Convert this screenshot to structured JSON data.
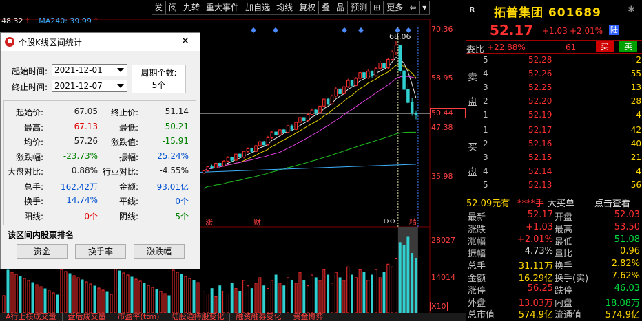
{
  "toolbar": [
    "发",
    "阅",
    "九转",
    "重大事件",
    "加自选",
    "均线",
    "复权",
    "叠",
    "品",
    "预测",
    "⊞",
    "更多",
    "⇦",
    "▾"
  ],
  "ma_legend": {
    "ma5": "48.32",
    "ma240": "MA240: 39.99"
  },
  "price_axis": [
    "70.36",
    "58.95",
    "47.38",
    "35.98"
  ],
  "current_price_tag": "50.44",
  "max_marker": "68.06",
  "chart_tags": {
    "zhang": "涨",
    "cai": "财",
    "period_marks": "↔↔",
    "jing": "精"
  },
  "vol_axis": [
    "28027",
    "14014"
  ],
  "vol_unit": "X10",
  "bottom_tabs": [
    "A行上核成交量",
    "盘后成交量",
    "市盈率(ttm)",
    "陆股通持股变化",
    "融资融券变化",
    "资金博弈"
  ],
  "dialog": {
    "title": "个股K线区间统计",
    "start_label": "起始时间:",
    "start_value": "2021-12-01",
    "end_label": "终止时间:",
    "end_value": "2021-12-07",
    "period_label": "周期个数:",
    "period_value": "5个",
    "stats_left": [
      {
        "label": "起始价:",
        "value": "67.05",
        "color": "black"
      },
      {
        "label": "最高:",
        "value": "67.13",
        "color": "red"
      },
      {
        "label": "均价:",
        "value": "57.26",
        "color": "black"
      },
      {
        "label": "涨跌幅:",
        "value": "-23.73%",
        "color": "green"
      },
      {
        "label": "大盘对比:",
        "value": "0.88%",
        "color": "black"
      },
      {
        "label": "总手:",
        "value": "162.42万",
        "color": "blue"
      },
      {
        "label": "换手:",
        "value": "14.74%",
        "color": "blue"
      },
      {
        "label": "阳线:",
        "value": "0个",
        "color": "red"
      }
    ],
    "stats_right": [
      {
        "label": "终止价:",
        "value": "51.14",
        "color": "black"
      },
      {
        "label": "最低:",
        "value": "50.21",
        "color": "green"
      },
      {
        "label": "涨跌值:",
        "value": "-15.91",
        "color": "green"
      },
      {
        "label": "振幅:",
        "value": "25.24%",
        "color": "blue"
      },
      {
        "label": "行业对比:",
        "value": "-4.55%",
        "color": "black"
      },
      {
        "label": "金额:",
        "value": "93.01亿",
        "color": "blue"
      },
      {
        "label": "平线:",
        "value": "0个",
        "color": "blue"
      },
      {
        "label": "阴线:",
        "value": "5个",
        "color": "green"
      }
    ],
    "rank_label": "该区间内股票排名",
    "buttons": [
      "资金",
      "换手率",
      "涨跌幅"
    ],
    "close": "✕"
  },
  "quote": {
    "r": "R",
    "name": "拓普集团 601689",
    "price": "52.17",
    "change": "+1.03",
    "pct": "+2.01%",
    "lu": "陆",
    "weibi_label": "委比",
    "weibi_pct": "+22.88%",
    "weibi_diff": "61",
    "buy_btn": "买",
    "sell_btn": "卖",
    "sell_side": [
      "卖",
      "盘"
    ],
    "buy_side": [
      "买",
      "盘"
    ],
    "asks": [
      {
        "lvl": "5",
        "price": "52.28",
        "vol": "2"
      },
      {
        "lvl": "4",
        "price": "52.26",
        "vol": "55"
      },
      {
        "lvl": "3",
        "price": "52.25",
        "vol": "13"
      },
      {
        "lvl": "2",
        "price": "52.20",
        "vol": "28"
      },
      {
        "lvl": "1",
        "price": "52.19",
        "vol": "4"
      }
    ],
    "bids": [
      {
        "lvl": "1",
        "price": "52.17",
        "vol": "42"
      },
      {
        "lvl": "2",
        "price": "52.16",
        "vol": "40"
      },
      {
        "lvl": "3",
        "price": "52.15",
        "vol": "21"
      },
      {
        "lvl": "4",
        "price": "52.14",
        "vol": "4"
      },
      {
        "lvl": "5",
        "price": "52.13",
        "vol": "56"
      }
    ],
    "bar": {
      "youyou": "52.09元有",
      "shou": "****手",
      "dmd": "大买单",
      "djck": "点击查看"
    },
    "stats": [
      {
        "l1": "最新",
        "v1": "52.17",
        "c1": "red",
        "l2": "开盘",
        "v2": "52.03",
        "c2": "red"
      },
      {
        "l1": "涨跌",
        "v1": "+1.03",
        "c1": "red",
        "l2": "最高",
        "v2": "53.50",
        "c2": "red"
      },
      {
        "l1": "涨幅",
        "v1": "+2.01%",
        "c1": "red",
        "l2": "最低",
        "v2": "51.08",
        "c2": "green"
      },
      {
        "l1": "振幅",
        "v1": "4.73%",
        "c1": "white",
        "l2": "量比",
        "v2": "0.96",
        "c2": "yellow"
      },
      {
        "l1": "总手",
        "v1": "31.11万",
        "c1": "yellow",
        "l2": "换手",
        "v2": "2.82%",
        "c2": "yellow"
      },
      {
        "l1": "金额",
        "v1": "16.29亿",
        "c1": "yellow",
        "l2": "换手(实)",
        "v2": "7.62%",
        "c2": "yellow"
      },
      {
        "l1": "涨停",
        "v1": "56.25",
        "c1": "red",
        "l2": "跌停",
        "v2": "46.03",
        "c2": "green"
      },
      {
        "l1": "外盘",
        "v1": "13.03万",
        "c1": "red",
        "l2": "内盘",
        "v2": "18.08万",
        "c2": "green"
      },
      {
        "l1": "总市值",
        "v1": "574.9亿",
        "c1": "yellow",
        "l2": "流通值",
        "v2": "574.9亿",
        "c2": "yellow"
      }
    ]
  },
  "chart_data": {
    "type": "candlestick",
    "ylim": [
      32,
      72
    ],
    "candles": [
      [
        38.0,
        38.6,
        37.8,
        38.5
      ],
      [
        38.5,
        39.6,
        38.3,
        39.4
      ],
      [
        39.4,
        39.9,
        38.9,
        39.1
      ],
      [
        39.1,
        40.5,
        39.0,
        40.2
      ],
      [
        40.2,
        40.4,
        39.2,
        39.6
      ],
      [
        39.6,
        40.9,
        39.4,
        40.7
      ],
      [
        40.7,
        41.8,
        40.5,
        41.5
      ],
      [
        41.5,
        41.7,
        40.6,
        40.9
      ],
      [
        40.9,
        42.6,
        40.8,
        42.3
      ],
      [
        42.3,
        42.4,
        41.2,
        41.6
      ],
      [
        41.6,
        43.1,
        41.3,
        42.9
      ],
      [
        42.9,
        43.8,
        42.5,
        43.5
      ],
      [
        43.5,
        43.7,
        42.6,
        42.9
      ],
      [
        42.9,
        44.5,
        42.7,
        44.2
      ],
      [
        44.2,
        45.4,
        43.9,
        45.1
      ],
      [
        45.1,
        45.3,
        44.0,
        44.4
      ],
      [
        44.4,
        46.4,
        44.2,
        46.0
      ],
      [
        46.0,
        47.6,
        45.7,
        47.3
      ],
      [
        47.3,
        47.5,
        46.1,
        46.6
      ],
      [
        46.6,
        48.0,
        46.4,
        47.8
      ],
      [
        47.8,
        48.2,
        46.9,
        47.2
      ],
      [
        47.2,
        48.9,
        47.0,
        48.7
      ],
      [
        48.7,
        49.0,
        47.6,
        47.9
      ],
      [
        47.9,
        49.8,
        47.7,
        49.5
      ],
      [
        49.5,
        50.9,
        49.3,
        50.6
      ],
      [
        50.6,
        50.8,
        49.4,
        49.9
      ],
      [
        49.9,
        51.6,
        49.7,
        51.3
      ],
      [
        51.3,
        52.6,
        51.1,
        52.3
      ],
      [
        52.3,
        52.5,
        51.2,
        51.7
      ],
      [
        51.7,
        53.5,
        51.5,
        53.2
      ],
      [
        53.2,
        55.1,
        53.0,
        54.8
      ],
      [
        54.8,
        55.0,
        53.3,
        53.7
      ],
      [
        53.7,
        55.8,
        53.5,
        55.5
      ],
      [
        55.5,
        57.5,
        55.2,
        57.1
      ],
      [
        57.1,
        57.3,
        55.6,
        56.0
      ],
      [
        56.0,
        57.9,
        55.8,
        57.6
      ],
      [
        57.6,
        59.4,
        57.3,
        59.0
      ],
      [
        59.0,
        59.2,
        57.5,
        57.9
      ],
      [
        57.9,
        59.8,
        57.7,
        59.5
      ],
      [
        59.5,
        61.2,
        59.3,
        60.8
      ],
      [
        60.8,
        61.0,
        59.2,
        59.6
      ],
      [
        59.6,
        61.5,
        59.4,
        61.1
      ],
      [
        61.1,
        61.3,
        59.6,
        60.1
      ],
      [
        60.1,
        62.1,
        59.9,
        61.8
      ],
      [
        61.8,
        63.4,
        61.5,
        63.0
      ],
      [
        63.0,
        63.2,
        61.4,
        61.9
      ],
      [
        61.9,
        64.2,
        61.7,
        63.8
      ],
      [
        63.8,
        65.9,
        63.5,
        65.5
      ],
      [
        65.5,
        68.06,
        64.8,
        67.05
      ],
      [
        67.05,
        67.13,
        60.5,
        61.2
      ],
      [
        61.2,
        62.0,
        56.0,
        57.0
      ],
      [
        57.0,
        58.3,
        53.5,
        54.0
      ],
      [
        54.0,
        55.0,
        51.0,
        51.6
      ],
      [
        51.6,
        52.2,
        50.21,
        51.14
      ]
    ],
    "volumes": [
      8,
      7,
      9,
      6,
      10,
      8,
      7,
      11,
      9,
      8,
      12,
      10,
      9,
      11,
      13,
      10,
      9,
      12,
      14,
      11,
      10,
      13,
      12,
      11,
      15,
      12,
      10,
      14,
      13,
      12,
      16,
      14,
      11,
      15,
      13,
      12,
      17,
      14,
      13,
      16,
      15,
      12,
      14,
      16,
      13,
      15,
      18,
      17,
      20,
      26,
      25,
      28,
      22,
      20
    ]
  }
}
